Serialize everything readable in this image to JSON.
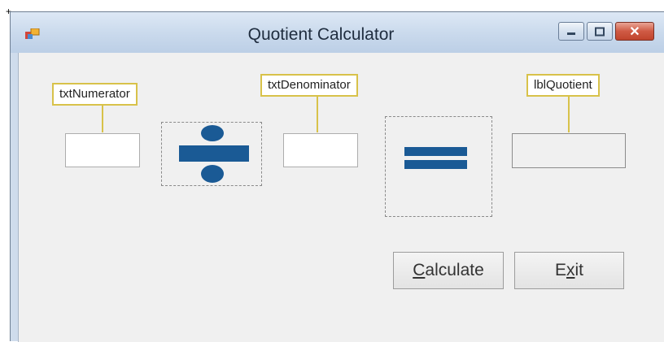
{
  "window": {
    "title": "Quotient Calculator",
    "close_glyph": "✕"
  },
  "callouts": {
    "numerator": "txtNumerator",
    "denominator": "txtDenominator",
    "quotient": "lblQuotient"
  },
  "buttons": {
    "calculate": {
      "pre": "",
      "mnemonic": "C",
      "post": "alculate"
    },
    "exit": {
      "pre": "E",
      "mnemonic": "x",
      "post": "it"
    }
  },
  "icons": {
    "app": "app-icon",
    "divide": "divide-icon",
    "equals": "equals-icon",
    "minimize": "minimize-icon",
    "maximize": "maximize-icon",
    "close": "close-icon"
  },
  "colors": {
    "accent": "#1a5a95",
    "callout_border": "#d8c24a"
  }
}
